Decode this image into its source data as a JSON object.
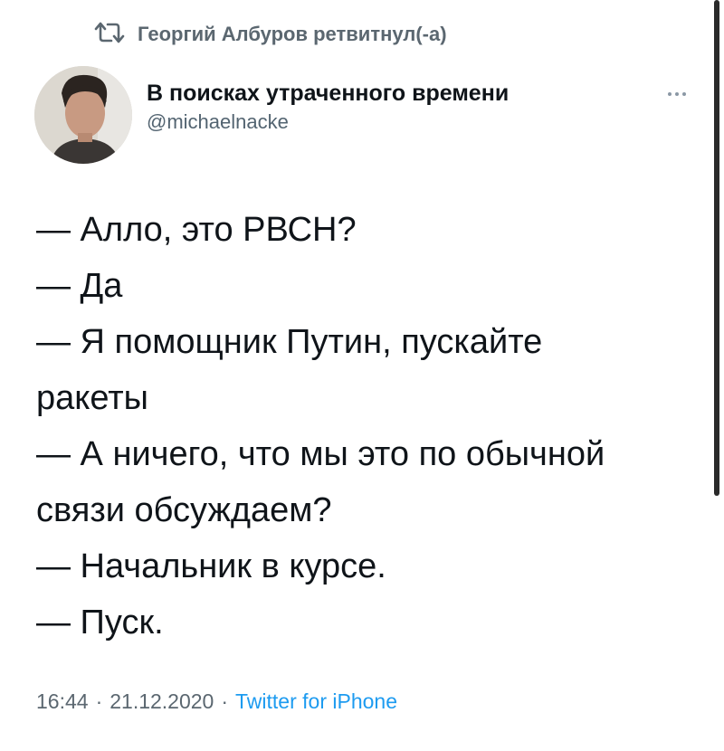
{
  "retweet": {
    "text": "Георгий Албуров ретвитнул(-а)",
    "icon": "retweet-icon"
  },
  "author": {
    "display_name": "В поисках утраченного времени",
    "handle": "@michaelnacke"
  },
  "tweet": {
    "lines": [
      "— Алло, это РВСН?",
      "— Да",
      "— Я помощник Путин, пускайте",
      "ракеты",
      "— А ничего, что мы это по обычной",
      "связи обсуждаем?",
      "— Начальник в курсе.",
      "— Пуск."
    ]
  },
  "meta": {
    "time": "16:44",
    "separator1": "·",
    "date": "21.12.2020",
    "separator2": "·",
    "source": "Twitter for iPhone"
  },
  "colors": {
    "text": "#0f1419",
    "secondary": "#536471",
    "link": "#1d9bf0"
  }
}
